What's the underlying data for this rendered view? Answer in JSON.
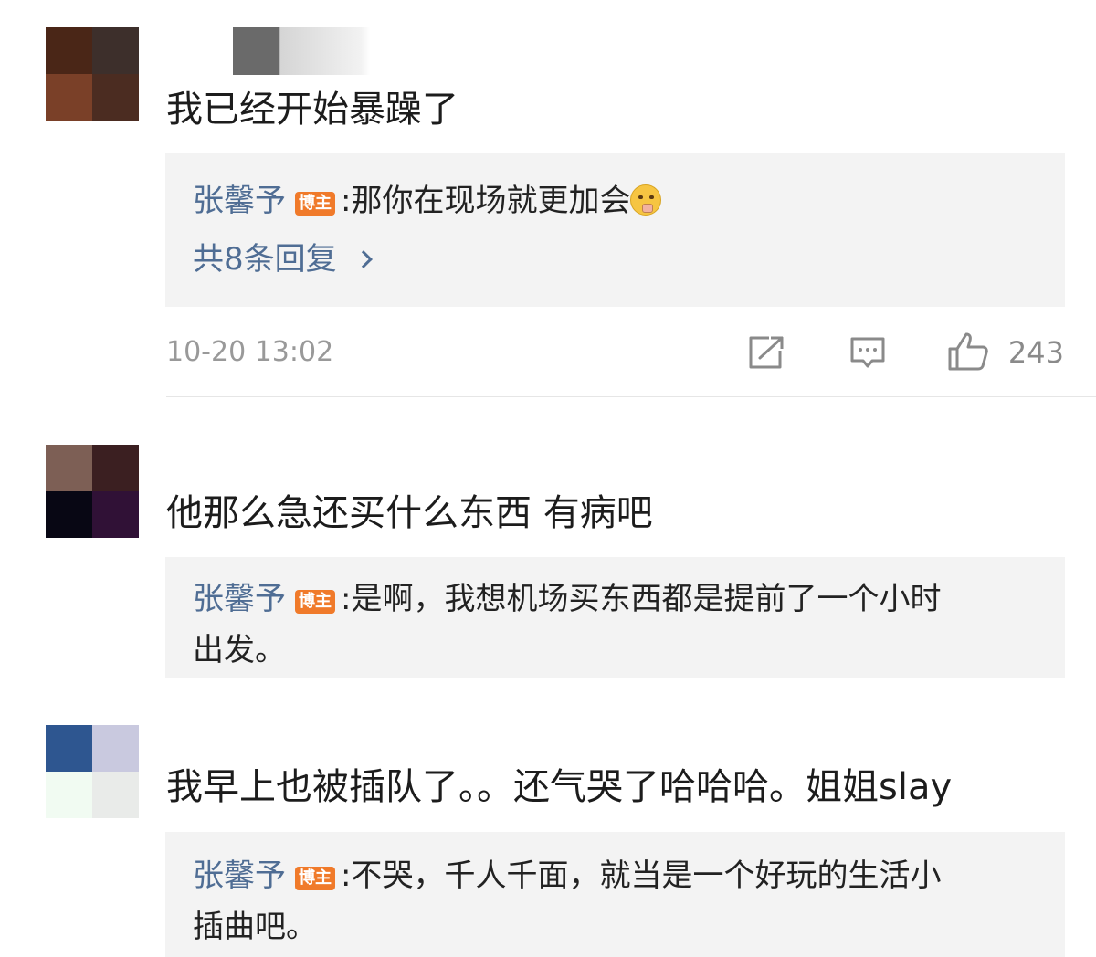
{
  "comments": [
    {
      "avatar_colors": [
        "#4a2617",
        "#3d2f2b",
        "#7a4028",
        "#4b2c21"
      ],
      "text": "我已经开始暴躁了",
      "reply": {
        "author": "张馨予",
        "badge": "博主",
        "separator": ":",
        "text": "那你在现场就更加会",
        "emoji": "shushing-face-emoji",
        "more": "共8条回复"
      },
      "meta": {
        "time": "10-20 13:02",
        "likes": "243",
        "icons": [
          "share-icon",
          "comment-icon",
          "like-icon"
        ]
      }
    },
    {
      "avatar_colors": [
        "#7d5f55",
        "#3b1f21",
        "#080714",
        "#301136"
      ],
      "text": "他那么急还买什么东西 有病吧",
      "reply": {
        "author": "张馨予",
        "badge": "博主",
        "separator": ":",
        "text_line1": "是啊，我想机场买东西都是提前了一个小时",
        "text_line2": "出发。"
      }
    },
    {
      "avatar_colors": [
        "#2e5690",
        "#c9c9df",
        "#f1fbf2",
        "#e9ebe9"
      ],
      "text": "我早上也被插队了。。还气哭了哈哈哈。姐姐slay",
      "reply": {
        "author": "张馨予",
        "badge": "博主",
        "separator": ":",
        "text_line1": "不哭，千人千面，就当是一个好玩的生活小",
        "text_line2": "插曲吧。"
      }
    }
  ]
}
